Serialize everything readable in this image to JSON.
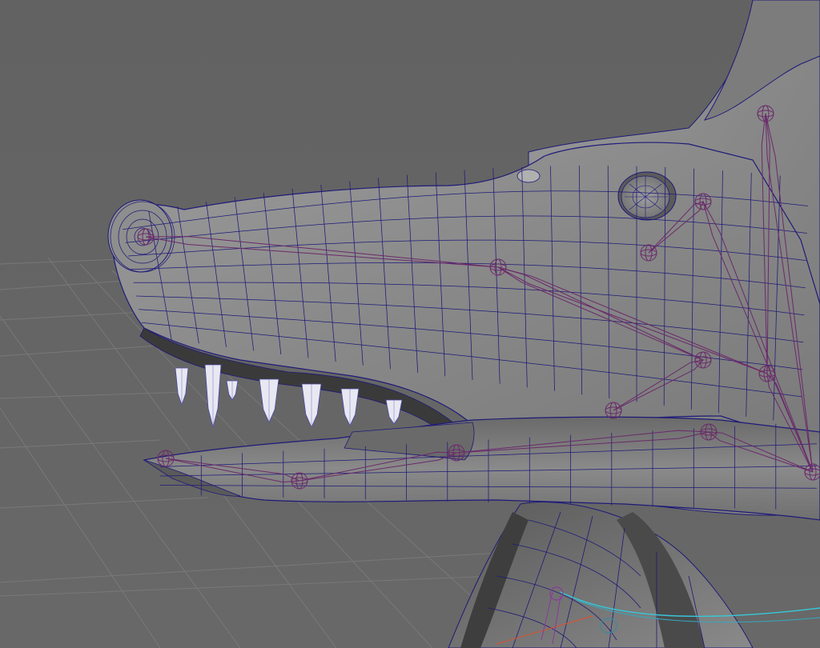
{
  "viewport": {
    "background_color": "#646464",
    "ground_grid_color": "#7a7a7a",
    "mesh_fill_color": "#8c8c8c",
    "mesh_shadow_color": "#3c3c3c",
    "wireframe_color": "#1e1a78",
    "joint_color": "#6a2a6a",
    "tooth_color": "#e8e8f2",
    "selection_highlight_color": "#35c8d8"
  }
}
